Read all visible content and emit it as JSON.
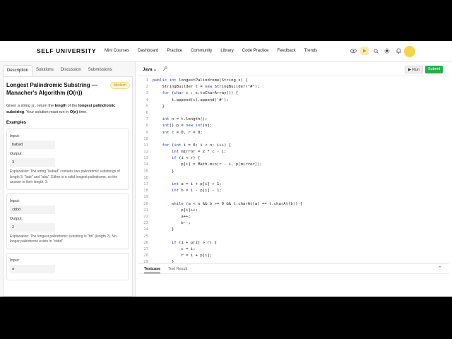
{
  "nav": {
    "brand": "SELF UNIVERSITY",
    "links": [
      "Mini Courses",
      "Dashboard",
      "Practice",
      "Community",
      "Library",
      "Code Practice",
      "Feedback",
      "Trends"
    ],
    "icons": [
      "eye-icon",
      "play-icon",
      "search-icon",
      "sun-icon",
      "bell-icon"
    ]
  },
  "problem": {
    "tabs": [
      "Description",
      "Solutions",
      "Discussion",
      "Submissions"
    ],
    "title": "Longest Palindromic Substring — Manacher's Algorithm (O(n))",
    "difficulty": "Medium",
    "desc_pre": "Given a string ",
    "desc_code": "s",
    "desc_mid1": ", return the ",
    "desc_bold1": "length",
    "desc_mid2": " of the ",
    "desc_bold2": "longest palindromic substring",
    "desc_mid3": ". Your solution must run in ",
    "desc_bold3": "O(n)",
    "desc_end": " time.",
    "examples_heading": "Examples",
    "input_label": "Input:",
    "output_label": "Output:",
    "explanation_label": "Explanation:",
    "examples": [
      {
        "input": "babad",
        "output": "3",
        "explanation": " The string \"babad\" contains two palindromic substrings of length 3: \"bab\" and \"aba\". Either is a valid longest palindrome, so the answer is their length, 3."
      },
      {
        "input": "cbbd",
        "output": "2",
        "explanation": " The longest palindromic substring is \"bb\" (length 2). No longer palindrome exists in \"cbbd\"."
      },
      {
        "input": "a",
        "output": "",
        "explanation": ""
      }
    ]
  },
  "editor": {
    "language": "Java",
    "run_label": "Run",
    "submit_label": "Submit",
    "bottom_tabs": [
      "Testcase",
      "Test Result"
    ],
    "lines": [
      "public int longestPalindrome(String s) {",
      "    StringBuilder t = new StringBuilder(\"#\");",
      "    for (char c : s.toCharArray()) {",
      "        t.append(c).append('#');",
      "    }",
      "",
      "    int n = t.length();",
      "    int[] p = new int[n];",
      "    int c = 0, r = 0;",
      "",
      "    for (int i = 0; i < n; i++) {",
      "        int mirror = 2 * c - i;",
      "        if (i < r) {",
      "            p[i] = Math.min(r - i, p[mirror]);",
      "        }",
      "",
      "        int a = i + p[i] + 1;",
      "        int b = i - p[i] - 1;",
      "",
      "        while (a < n && b >= 0 && t.charAt(a) == t.charAt(b)) {",
      "            p[i]++;",
      "            a++;",
      "            b--;",
      "        }",
      "",
      "        if (i + p[i] > r) {",
      "            c = i;",
      "            r = i + p[i];",
      "        }",
      "    }",
      "}"
    ]
  }
}
